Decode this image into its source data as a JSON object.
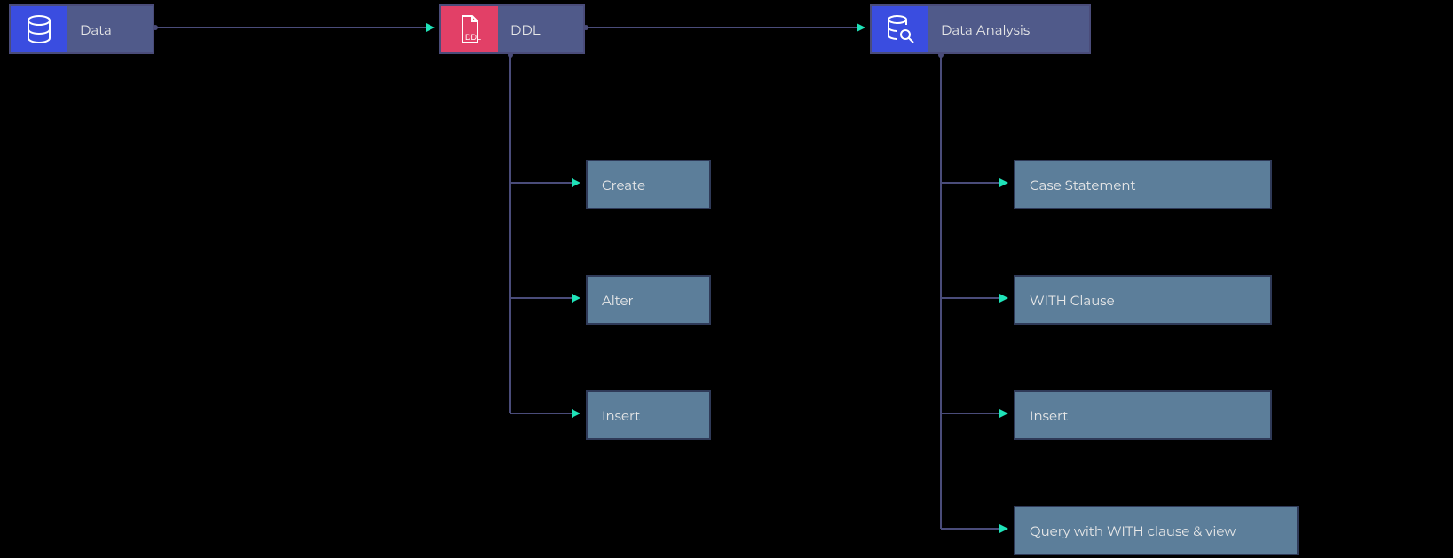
{
  "nodes": {
    "data": {
      "label": "Data",
      "icon": "database-icon"
    },
    "ddl": {
      "label": "DDL",
      "icon": "ddl-file-icon"
    },
    "analysis": {
      "label": "Data Analysis",
      "icon": "db-search-icon"
    }
  },
  "ddl_children": [
    {
      "label": "Create"
    },
    {
      "label": "Alter"
    },
    {
      "label": "Insert"
    }
  ],
  "analysis_children": [
    {
      "label": "Case Statement"
    },
    {
      "label": "WITH Clause"
    },
    {
      "label": "Insert"
    },
    {
      "label": "Query with WITH clause & view"
    }
  ],
  "colors": {
    "arrow": "#1fe3b8",
    "line": "#4a4c7a"
  }
}
